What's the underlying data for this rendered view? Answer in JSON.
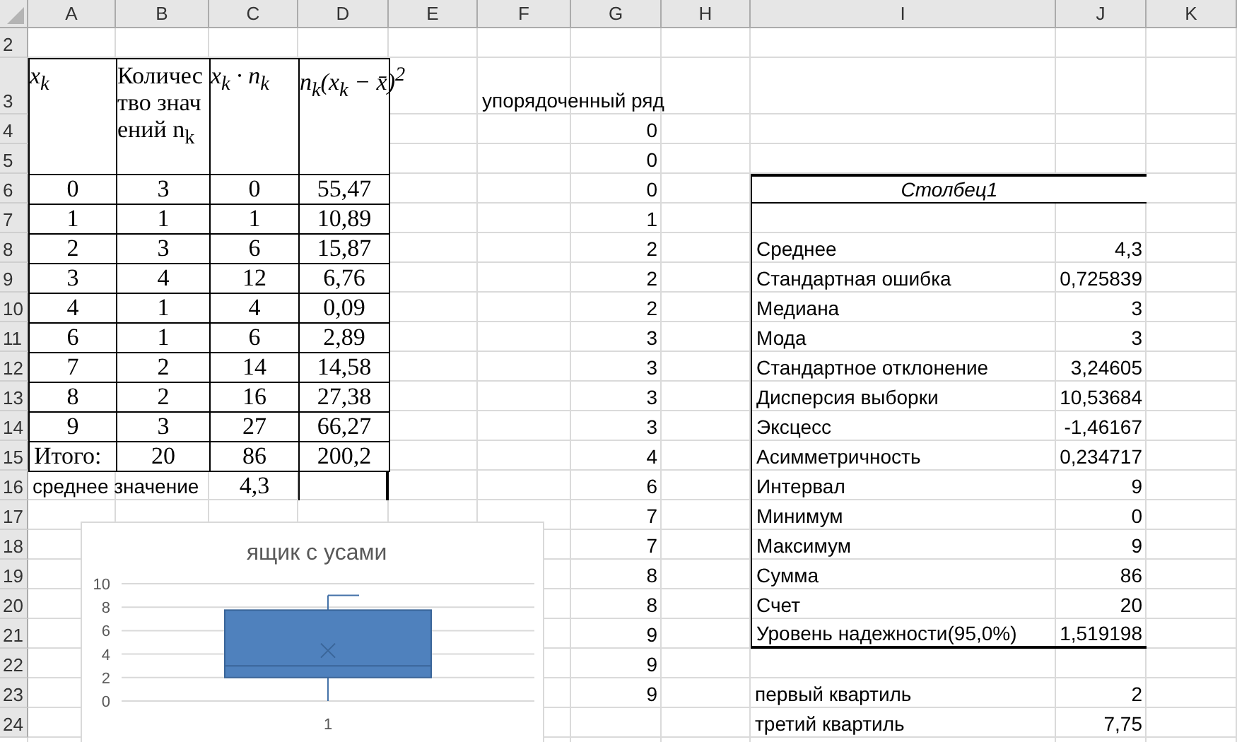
{
  "column_headers": [
    "A",
    "B",
    "C",
    "D",
    "E",
    "F",
    "G",
    "H",
    "I",
    "J",
    "K"
  ],
  "row_headers": [
    "2",
    "3",
    "4",
    "5",
    "6",
    "7",
    "8",
    "9",
    "10",
    "11",
    "12",
    "13",
    "14",
    "15",
    "16",
    "17",
    "18",
    "19",
    "20",
    "21",
    "22",
    "23",
    "24"
  ],
  "frequency_table": {
    "header": [
      "x$_{k}$",
      "Количество значений n$_{k}$",
      "x$_{k}$ · n$_{k}$",
      "n$_{k}$(x$_{k}$ − x̄)$^{2}$"
    ],
    "rows": [
      [
        "0",
        "3",
        "0",
        "55,47"
      ],
      [
        "1",
        "1",
        "1",
        "10,89"
      ],
      [
        "2",
        "3",
        "6",
        "15,87"
      ],
      [
        "3",
        "4",
        "12",
        "6,76"
      ],
      [
        "4",
        "1",
        "4",
        "0,09"
      ],
      [
        "6",
        "1",
        "6",
        "2,89"
      ],
      [
        "7",
        "2",
        "14",
        "14,58"
      ],
      [
        "8",
        "2",
        "16",
        "27,38"
      ],
      [
        "9",
        "3",
        "27",
        "66,27"
      ]
    ],
    "total": [
      "Итого:",
      "20",
      "86",
      "200,2"
    ],
    "mean": {
      "label": "среднее значение",
      "value": "4,3"
    }
  },
  "ordered_series": {
    "title": "упорядоченный ряд",
    "values": [
      "0",
      "0",
      "0",
      "1",
      "2",
      "2",
      "2",
      "3",
      "3",
      "3",
      "3",
      "4",
      "6",
      "7",
      "7",
      "8",
      "8",
      "9",
      "9",
      "9"
    ]
  },
  "statistics": {
    "title": "Столбец1",
    "rows": [
      {
        "label": "Среднее",
        "value": "4,3"
      },
      {
        "label": "Стандартная ошибка",
        "value": "0,725839"
      },
      {
        "label": "Медиана",
        "value": "3"
      },
      {
        "label": "Мода",
        "value": "3"
      },
      {
        "label": "Стандартное отклонение",
        "value": "3,24605"
      },
      {
        "label": "Дисперсия выборки",
        "value": "10,53684"
      },
      {
        "label": "Эксцесс",
        "value": "-1,46167"
      },
      {
        "label": "Асимметричность",
        "value": "0,234717"
      },
      {
        "label": "Интервал",
        "value": "9"
      },
      {
        "label": "Минимум",
        "value": "0"
      },
      {
        "label": "Максимум",
        "value": "9"
      },
      {
        "label": "Сумма",
        "value": "86"
      },
      {
        "label": "Счет",
        "value": "20"
      },
      {
        "label": "Уровень надежности(95,0%)",
        "value": "1,519198"
      }
    ]
  },
  "quartiles": [
    {
      "label": "первый квартиль",
      "value": "2"
    },
    {
      "label": "третий квартиль",
      "value": "7,75"
    }
  ],
  "chart": {
    "title": "ящик с усами",
    "y_axis_labels": [
      "10",
      "8",
      "6",
      "4",
      "2",
      "0"
    ],
    "x_axis_label": "1"
  }
}
